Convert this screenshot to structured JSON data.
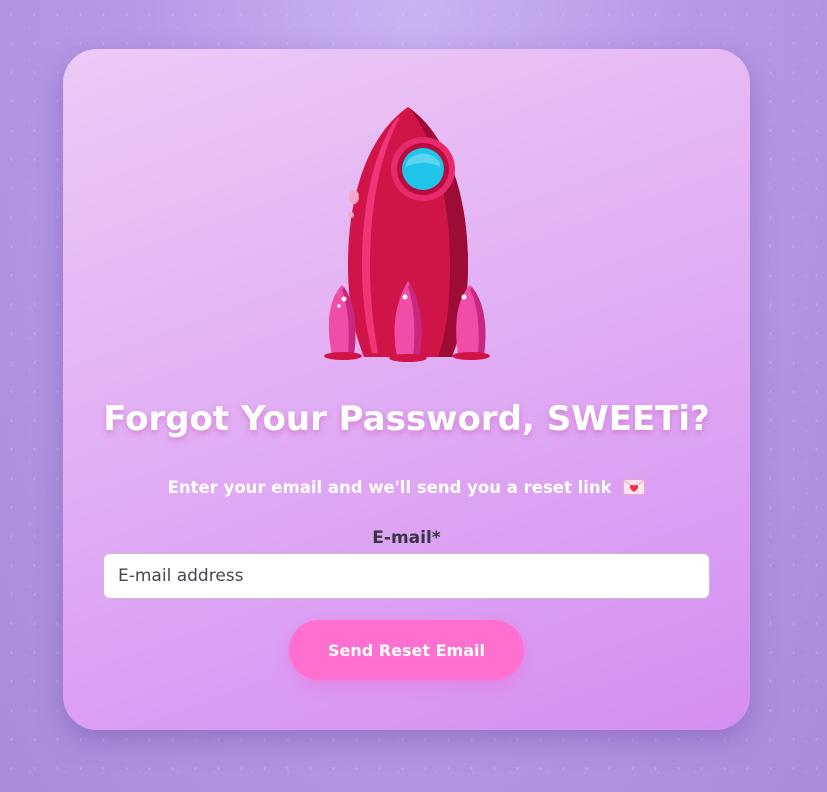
{
  "card": {
    "title": "Forgot Your Password, SWEETi?",
    "subtitle": "Enter your email and we'll send you a reset link",
    "subtitle_icon": "love-letter-icon"
  },
  "form": {
    "email_label": "E-mail*",
    "email_value": "",
    "email_placeholder": "E-mail address",
    "submit_label": "Send Reset Email"
  },
  "illustration": {
    "icon": "rocket-icon"
  },
  "colors": {
    "button": "#ff6fd0",
    "rocket": "#d11447",
    "porthole": "#20c4e8",
    "card_top": "#eccaf6",
    "card_bottom": "#d48ef2"
  }
}
